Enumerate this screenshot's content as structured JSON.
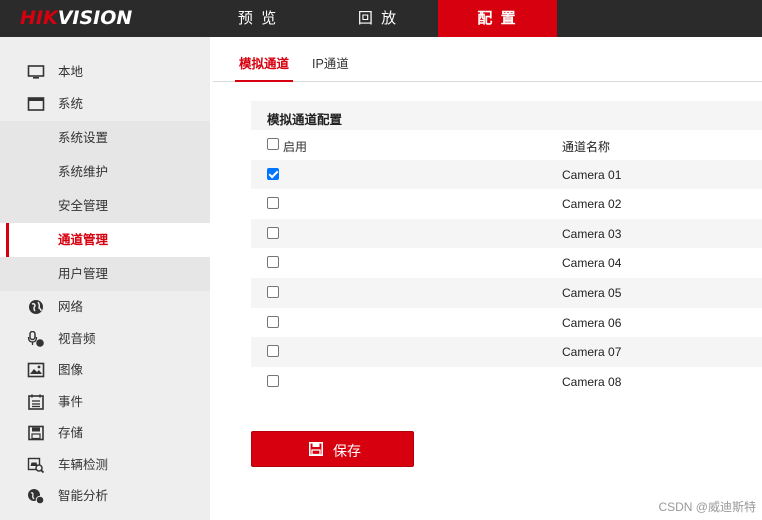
{
  "logo": {
    "text_red": "HIK",
    "text_white": "VISION"
  },
  "nav": {
    "items": [
      "预 览",
      "回 放",
      "配 置"
    ]
  },
  "sidebar": {
    "items": [
      {
        "label": "本地",
        "icon": "monitor-icon"
      },
      {
        "label": "系统",
        "icon": "window-icon"
      },
      {
        "label": "系统设置"
      },
      {
        "label": "系统维护"
      },
      {
        "label": "安全管理"
      },
      {
        "label": "通道管理"
      },
      {
        "label": "用户管理"
      },
      {
        "label": "网络",
        "icon": "globe-icon"
      },
      {
        "label": "视音频",
        "icon": "microphone-icon"
      },
      {
        "label": "图像",
        "icon": "image-icon"
      },
      {
        "label": "事件",
        "icon": "calendar-icon"
      },
      {
        "label": "存储",
        "icon": "disk-icon"
      },
      {
        "label": "车辆检测",
        "icon": "car-search-icon"
      },
      {
        "label": "智能分析",
        "icon": "analysis-icon"
      }
    ]
  },
  "tabs": [
    "模拟通道",
    "IP通道"
  ],
  "table": {
    "title": "模拟通道配置",
    "header_enable": "启用",
    "header_name": "通道名称",
    "rows": [
      {
        "name": "Camera 01",
        "enabled": true
      },
      {
        "name": "Camera 02",
        "enabled": false
      },
      {
        "name": "Camera 03",
        "enabled": false
      },
      {
        "name": "Camera 04",
        "enabled": false
      },
      {
        "name": "Camera 05",
        "enabled": false
      },
      {
        "name": "Camera 06",
        "enabled": false
      },
      {
        "name": "Camera 07",
        "enabled": false
      },
      {
        "name": "Camera 08",
        "enabled": false
      }
    ]
  },
  "save_button": {
    "label": "保存",
    "icon": "floppy-icon"
  },
  "watermark": "CSDN @威迪斯特",
  "colors": {
    "accent": "#d7000f",
    "topbar": "#2b2b2b",
    "sidebar": "#eeeeee"
  }
}
